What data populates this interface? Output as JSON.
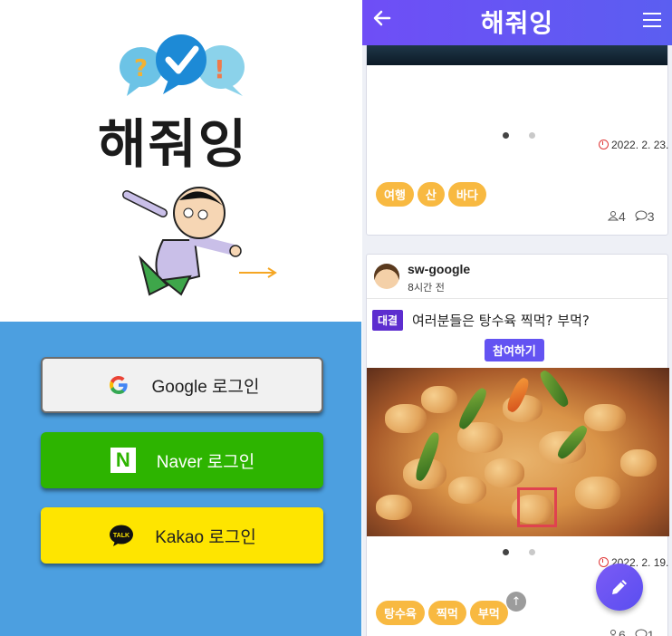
{
  "login": {
    "app_title": "해줘잉",
    "logo_bubbles": {
      "left_glyph": "?",
      "right_glyph": "!"
    },
    "buttons": [
      {
        "id": "google",
        "label": "Google 로그인",
        "icon": "google-logo-icon",
        "bg": "#f1f1f1"
      },
      {
        "id": "naver",
        "label": "Naver 로그인",
        "icon": "naver-n-icon",
        "icon_text": "N",
        "bg": "#2db400"
      },
      {
        "id": "kakao",
        "label": "Kakao 로그인",
        "icon": "kakao-talk-icon",
        "icon_text": "TALK",
        "bg": "#fee500"
      }
    ],
    "bottom_color": "#4c9fe0"
  },
  "feed": {
    "topbar": {
      "title": "해줘잉",
      "back_icon": "back-arrow-icon",
      "menu_icon": "hamburger-menu-icon"
    },
    "posts": [
      {
        "date": "2022. 2. 23.",
        "tags": [
          "여행",
          "산",
          "바다"
        ],
        "likes": "4",
        "comments": "3",
        "slides": 2,
        "active_slide": 1
      },
      {
        "user": "sw-google",
        "time_ago": "8시간 전",
        "badge": "대결",
        "title": "여러분들은 탕수육 찍먹? 부먹?",
        "join_label": "참여하기",
        "date": "2022. 2. 19.",
        "tags": [
          "탕수육",
          "찍먹",
          "부먹"
        ],
        "likes": "6",
        "comments": "1",
        "slides": 2,
        "active_slide": 1
      }
    ],
    "fab_icon": "pencil-icon",
    "scroll_top_icon": "arrow-up-icon"
  },
  "colors": {
    "accent": "#6353f2",
    "tag": "#f8b941",
    "badge": "#5d2dcf"
  }
}
